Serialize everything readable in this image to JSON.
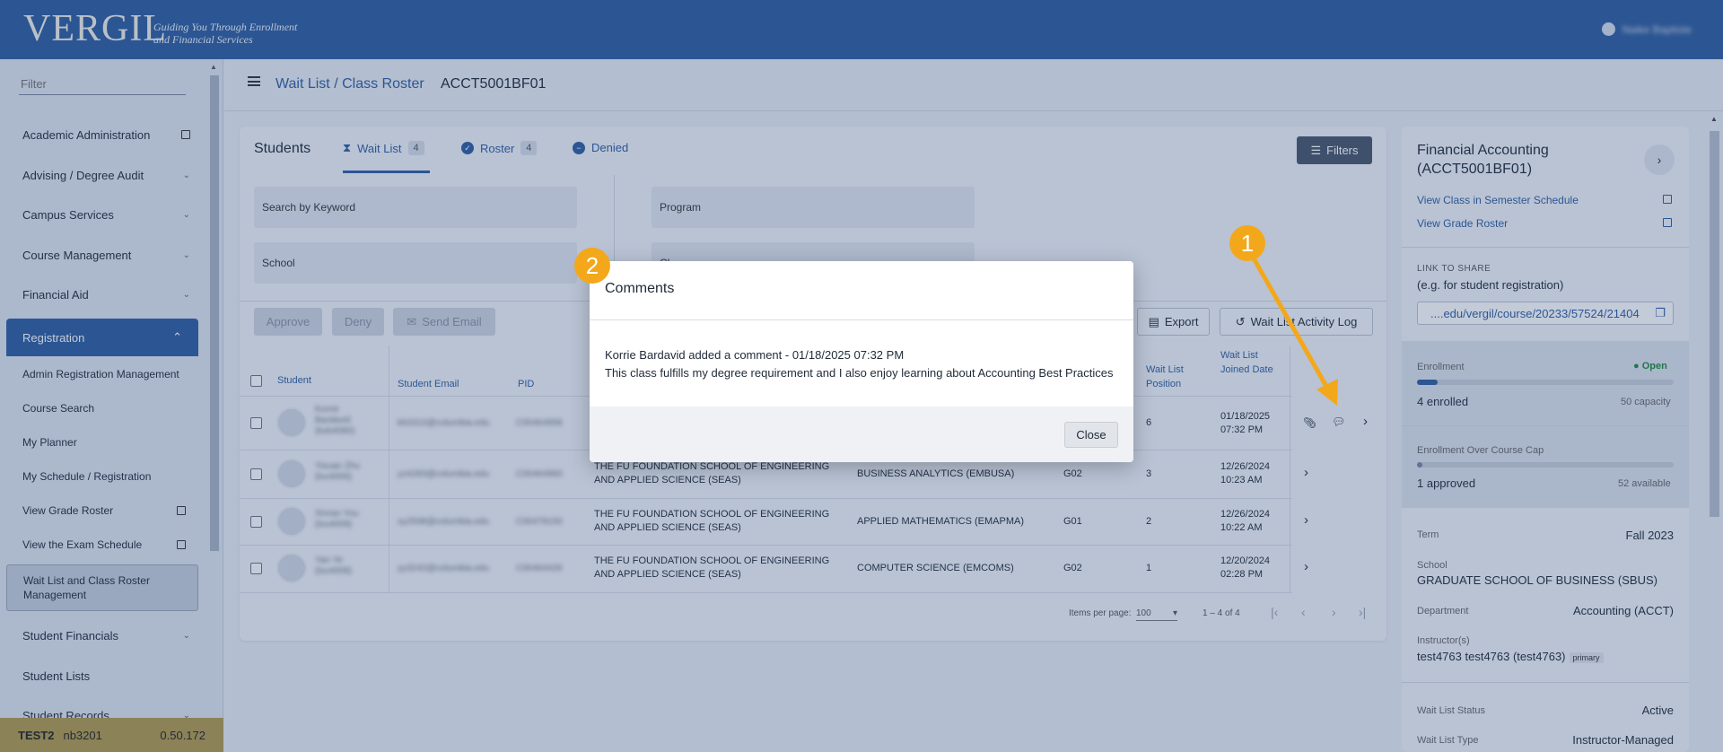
{
  "header": {
    "logo_text": "VERGIL",
    "tagline": "Guiding You Through Enrollment and Financial Services",
    "user_name": "Naike Baptiste"
  },
  "sidebar": {
    "filter_placeholder": "Filter",
    "items": [
      {
        "label": "Academic Administration",
        "icon": "external-link-icon"
      },
      {
        "label": "Advising / Degree Audit",
        "icon": "chevron-down-icon"
      },
      {
        "label": "Campus Services",
        "icon": "chevron-down-icon"
      },
      {
        "label": "Course Management",
        "icon": "chevron-down-icon"
      },
      {
        "label": "Financial Aid",
        "icon": "chevron-down-icon"
      }
    ],
    "registration": {
      "label": "Registration",
      "subitems": [
        {
          "label": "Admin Registration Management",
          "icon": ""
        },
        {
          "label": "Course Search",
          "icon": ""
        },
        {
          "label": "My Planner",
          "icon": ""
        },
        {
          "label": "My Schedule / Registration",
          "icon": ""
        },
        {
          "label": "View Grade Roster",
          "icon": "external-link-icon"
        },
        {
          "label": "View the Exam Schedule",
          "icon": "external-link-icon"
        },
        {
          "label": "Wait List and Class Roster Management",
          "icon": ""
        }
      ]
    },
    "bottom_items": [
      {
        "label": "Student Financials",
        "icon": "chevron-down-icon"
      },
      {
        "label": "Student Lists",
        "icon": ""
      },
      {
        "label": "Student Records",
        "icon": "chevron-down-icon"
      }
    ],
    "env": {
      "name": "TEST2",
      "user": "nb3201",
      "version": "0.50.172"
    }
  },
  "page": {
    "breadcrumb": "Wait List / Class Roster",
    "class_id": "ACCT5001BF01"
  },
  "students": {
    "title": "Students",
    "tabs": [
      {
        "label": "Wait List",
        "count": "4"
      },
      {
        "label": "Roster",
        "count": "4"
      },
      {
        "label": "Denied",
        "count": ""
      }
    ],
    "filters_label": "Filters",
    "search_keyword": "Search by Keyword",
    "program": "Program",
    "school": "School",
    "fourth_filter": "Cl...",
    "actions": {
      "approve": "Approve",
      "deny": "Deny",
      "send_email": "Send Email",
      "export": "Export",
      "activity_log": "Wait List Activity Log"
    },
    "columns": {
      "student": "Student",
      "email": "Student Email",
      "pid": "PID",
      "position": "Wait List Position",
      "joined": "Wait List Joined Date"
    },
    "rows": [
      {
        "name": "Korrie Bardavid (kxb4080)",
        "email": "kb3310@columbia.edu",
        "pid": "C00464958",
        "school": "",
        "program": "",
        "section": "",
        "position": "6",
        "joined": "01/18/2025 07:32 PM"
      },
      {
        "name": "Yixuan Zhu (lxx4006)",
        "email": "yz4283@columbia.edu",
        "pid": "C00464960",
        "school": "THE FU FOUNDATION SCHOOL OF ENGINEERING AND APPLIED SCIENCE (SEAS)",
        "program": "BUSINESS ANALYTICS (EMBUSA)",
        "section": "G02",
        "position": "3",
        "joined": "12/26/2024 10:23 AM"
      },
      {
        "name": "Xinran You (lxx4009)",
        "email": "xy2938@columbia.edu",
        "pid": "C00478150",
        "school": "THE FU FOUNDATION SCHOOL OF ENGINEERING AND APPLIED SCIENCE (SEAS)",
        "program": "APPLIED MATHEMATICS (EMAPMA)",
        "section": "G01",
        "position": "2",
        "joined": "12/26/2024 10:22 AM"
      },
      {
        "name": "Yan Ye (lxx4008)",
        "email": "yy3242@columbia.edu",
        "pid": "C00464426",
        "school": "THE FU FOUNDATION SCHOOL OF ENGINEERING AND APPLIED SCIENCE (SEAS)",
        "program": "COMPUTER SCIENCE (EMCOMS)",
        "section": "G02",
        "position": "1",
        "joined": "12/20/2024 02:28 PM"
      }
    ],
    "pager": {
      "items_per_page_label": "Items per page:",
      "items_per_page": "100",
      "range": "1 – 4 of 4"
    }
  },
  "right_panel": {
    "title": "Financial Accounting (ACCT5001BF01)",
    "link_schedule": "View Class in Semester Schedule",
    "link_grade_roster": "View Grade Roster",
    "share_label": "LINK TO SHARE",
    "share_hint": "(e.g. for student registration)",
    "share_url": "....edu/vergil/course/20233/57524/21404",
    "enrollment_label": "Enrollment",
    "enrollment_status": "Open",
    "enrolled": "4 enrolled",
    "capacity": "50 capacity",
    "enrollment_fraction": 0.08,
    "over_cap_label": "Enrollment Over Course Cap",
    "approved": "1 approved",
    "available": "52 available",
    "over_cap_fraction": 0.02,
    "term_label": "Term",
    "term": "Fall 2023",
    "school_label": "School",
    "school": "GRADUATE SCHOOL OF BUSINESS (SBUS)",
    "department_label": "Department",
    "department": "Accounting (ACCT)",
    "instructor_label": "Instructor(s)",
    "instructor": "test4763 test4763 (test4763)",
    "instructor_badge": "primary",
    "wl_status_label": "Wait List Status",
    "wl_status": "Active",
    "wl_type_label": "Wait List Type",
    "wl_type": "Instructor-Managed"
  },
  "dialog": {
    "title": "Comments",
    "meta": "Korrie Bardavid added a comment - 01/18/2025 07:32 PM",
    "body": "This class fulfills my degree requirement and I also enjoy learning about Accounting Best Practices",
    "close_label": "Close"
  },
  "callouts": {
    "one": "1",
    "two": "2"
  },
  "colors": {
    "brand": "#2f5d9e",
    "accent": "#f3a81b",
    "open": "#1f8a3c"
  }
}
